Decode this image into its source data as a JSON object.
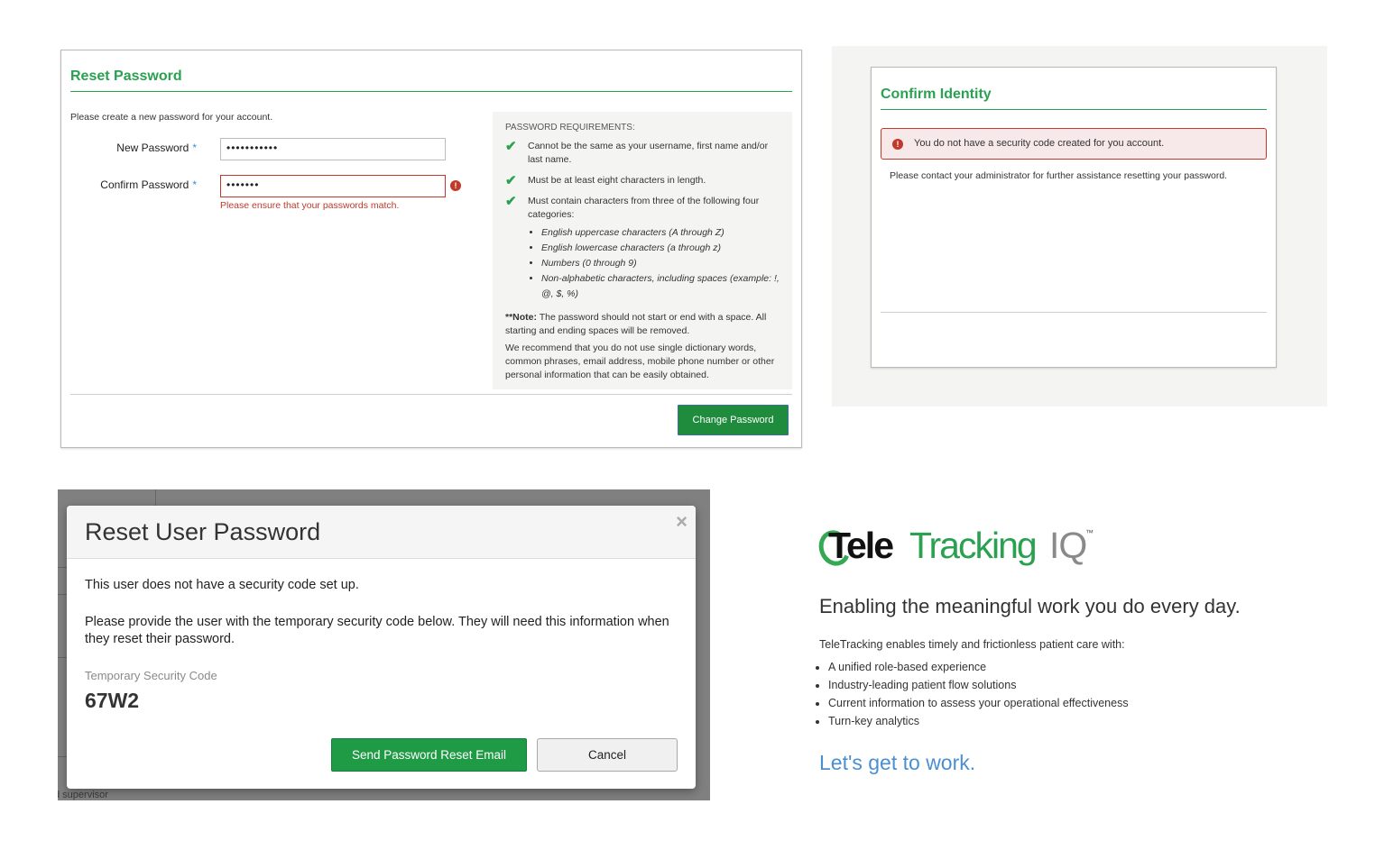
{
  "reset_password": {
    "title": "Reset Password",
    "intro": "Please create a new password for your account.",
    "new_password_label": "New Password",
    "new_password_value": "•••••••••••",
    "confirm_password_label": "Confirm Password",
    "confirm_password_value": "•••••••",
    "required_mark": "*",
    "error_icon": "!",
    "error_message": "Please ensure that your passwords match.",
    "requirements": {
      "heading": "PASSWORD REQUIREMENTS:",
      "items": [
        "Cannot be the same as your username, first name and/or last name.",
        "Must be at least eight characters in length.",
        "Must contain characters from three of the following four categories:"
      ],
      "categories": [
        "English uppercase characters (A through Z)",
        "English lowercase characters (a through z)",
        "Numbers (0 through 9)",
        "Non-alphabetic characters, including spaces (example: !, @, $, %)"
      ],
      "note_label": "**Note:",
      "note_text": " The password should not start or end with a space. All starting and ending spaces will be removed.",
      "recommendation": "We recommend that you do not use single dictionary words, common phrases, email address, mobile phone number or other personal information that can be easily obtained."
    },
    "submit_label": "Change Password"
  },
  "confirm_identity": {
    "title": "Confirm Identity",
    "alert_icon": "!",
    "alert_text": "You do not have a security code created for you account.",
    "message": "Please contact your administrator for further assistance resetting your password."
  },
  "reset_user_modal": {
    "title": "Reset User Password",
    "close_glyph": "×",
    "line1": "This user does not have a security code set up.",
    "line2": "Please provide the user with the temporary security code below. They will need this information when they reset their password.",
    "code_label": "Temporary Security Code",
    "code_value": "67W2",
    "send_label": "Send Password Reset Email",
    "cancel_label": "Cancel",
    "background_text": "d supervisor"
  },
  "teletracking": {
    "logo_tele": "Tele",
    "logo_tracking": "Tracking",
    "logo_iq": "IQ",
    "logo_tm": "™",
    "tagline": "Enabling the meaningful work you do every day.",
    "intro": "TeleTracking enables timely and frictionless patient care with:",
    "bullets": [
      "A unified role-based experience",
      "Industry-leading patient flow solutions",
      "Current information to assess your operational effectiveness",
      "Turn-key analytics"
    ],
    "cta": "Let's get to work."
  },
  "colors": {
    "brand_green": "#2aa150",
    "error_red": "#c0392b",
    "link_blue": "#4a8fd0"
  },
  "icons": {
    "check": "check-icon",
    "error": "exclamation-circle-icon",
    "close": "close-icon"
  }
}
